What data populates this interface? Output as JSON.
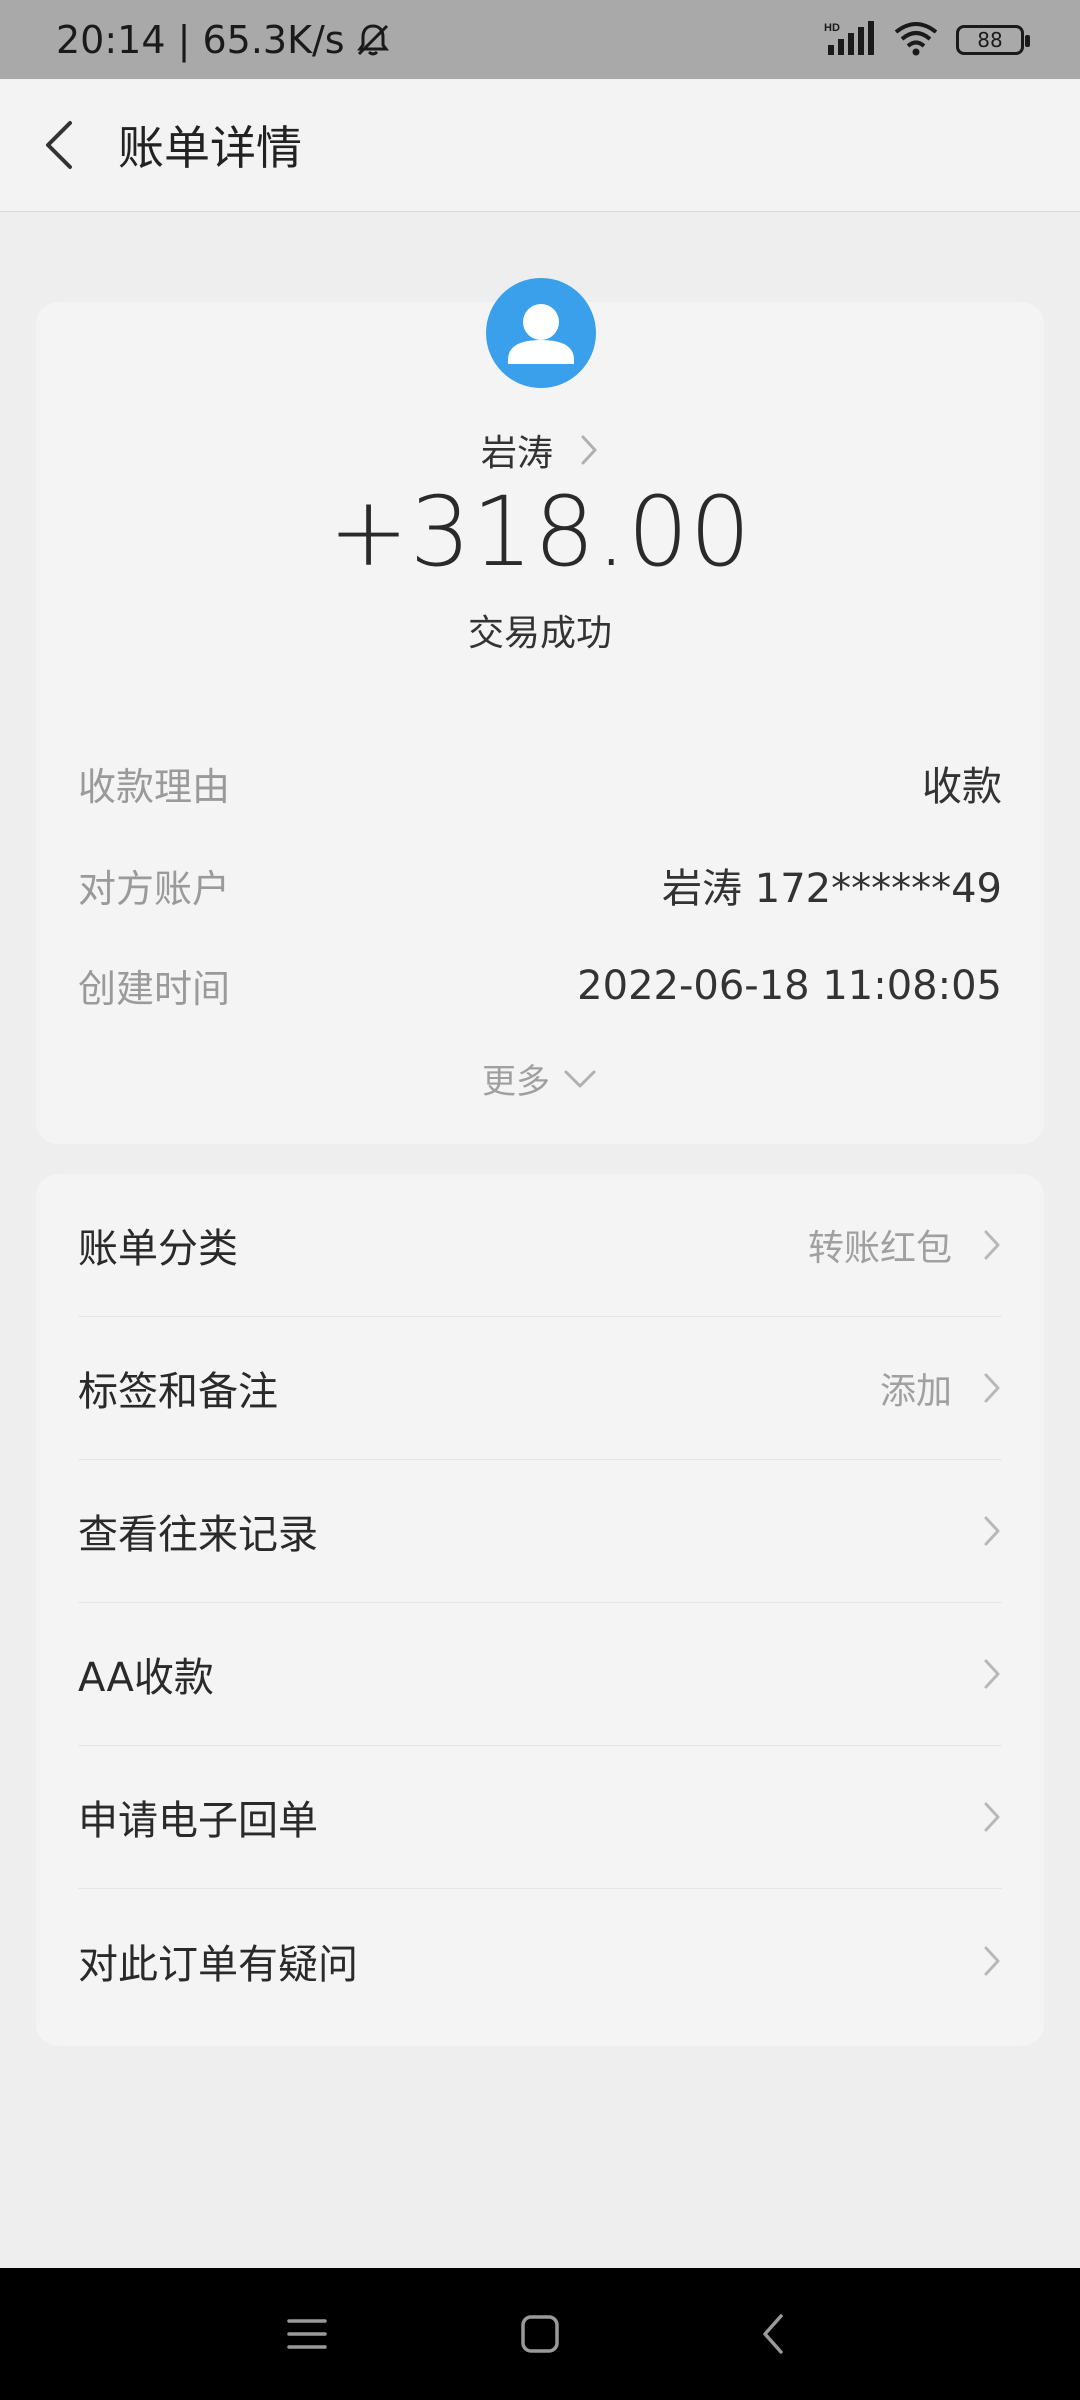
{
  "status_bar": {
    "time_speed": "20:14 | 65.3K/s",
    "battery": "88",
    "icons": [
      "bell-off-icon",
      "hd-signal-icon",
      "wifi-icon",
      "battery-icon"
    ]
  },
  "header": {
    "title": "账单详情",
    "back_icon": "chevron-left-icon"
  },
  "summary": {
    "payee_name": "岩涛",
    "amount": "+318.00",
    "status": "交易成功",
    "avatar_color": "#3ba0ec"
  },
  "details": {
    "rows": [
      {
        "label": "收款理由",
        "value": "收款"
      },
      {
        "label": "对方账户",
        "value": "岩涛 172******49"
      },
      {
        "label": "创建时间",
        "value": "2022-06-18 11:08:05"
      }
    ],
    "more_label": "更多"
  },
  "actions": {
    "items": [
      {
        "label": "账单分类",
        "value": "转账红包"
      },
      {
        "label": "标签和备注",
        "value": "添加"
      },
      {
        "label": "查看往来记录",
        "value": ""
      },
      {
        "label": "AA收款",
        "value": ""
      },
      {
        "label": "申请电子回单",
        "value": ""
      },
      {
        "label": "对此订单有疑问",
        "value": ""
      }
    ]
  },
  "nav_bar": {
    "icons": [
      "menu-icon",
      "home-icon",
      "back-icon"
    ]
  }
}
